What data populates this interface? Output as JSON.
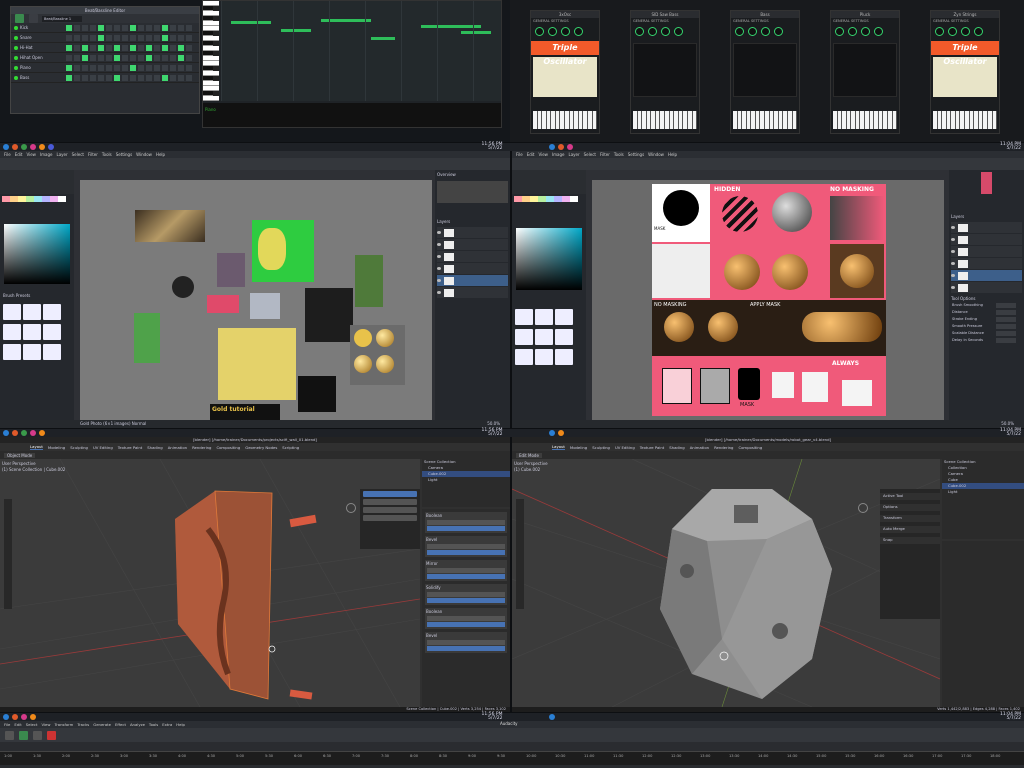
{
  "q1": {
    "beat_editor_title": "Beat/Bassline Editor",
    "beat_selector": "Beat/Bassline 1",
    "tracks": [
      "Kick",
      "Snare",
      "Hi-Hat",
      "Hihat Open",
      "Piano",
      "Bass"
    ],
    "piano_label": "Piano"
  },
  "q2": {
    "synths": [
      {
        "title": "3xOsc",
        "banner": "Triple Oscillator",
        "type": "triple"
      },
      {
        "title": "SID Saw Bass",
        "banner": "",
        "type": "dark"
      },
      {
        "title": "Bass",
        "banner": "",
        "type": "dark"
      },
      {
        "title": "Pluck",
        "banner": "",
        "type": "dark"
      },
      {
        "title": "Zyn Strings",
        "banner": "Triple Oscillator",
        "type": "triple"
      }
    ],
    "general_settings": "GENERAL SETTINGS"
  },
  "taskbars": {
    "clock_time": "11:56 PM",
    "clock_date": "5/7/22",
    "right_clock_time": "11:04 PM",
    "right_clock_date": "5/7/22"
  },
  "krita_left": {
    "title": "rewrite_progression_008.kra (2.0 GiB) * — Krita",
    "menu": [
      "File",
      "Edit",
      "View",
      "Image",
      "Layer",
      "Select",
      "Filter",
      "Tools",
      "Settings",
      "Window",
      "Help"
    ],
    "overview_title": "Overview",
    "layers_title": "Layers",
    "brush_presets_title": "Brush Presets",
    "status_left": "Gold Photo (6×1 images)   Normal",
    "zoom": "50.0%"
  },
  "krita_right": {
    "title": "spheres_003.kra (2.0 GiB) — Krita",
    "menu": [
      "File",
      "Edit",
      "View",
      "Image",
      "Layer",
      "Select",
      "Filter",
      "Tools",
      "Settings",
      "Window",
      "Help"
    ],
    "layers_title": "Layers",
    "tool_options_title": "Tool Options",
    "panels": [
      {
        "label": "MASK",
        "sub": "BLACK=SHOW\nWHITE=HIDE"
      },
      {
        "label": "HIDDEN",
        "sub": "SIMPLY HIDE PART OF LAYER"
      },
      {
        "label": "NO MASKING",
        "sub": ""
      },
      {
        "label": "NO MASKING",
        "sub": ""
      },
      {
        "label": "APPLY MASK",
        "sub": "TO MAKE IT PERMANENT"
      },
      {
        "label": "ALWAYS",
        "sub": "NON DESTRUCTIVE"
      },
      {
        "label": "MASK",
        "sub": ""
      }
    ],
    "tool_labels": [
      "Brush Smoothing",
      "Distance",
      "Stroke Ending",
      "Smooth Pressure",
      "Scalable Distance",
      "Delay in Seconds"
    ],
    "zoom": "50.0%"
  },
  "blender_left": {
    "title": "[blender] [/home/trainer/Documents/projects/scifi_wall_01.blend]",
    "workspaces": [
      "Layout",
      "Modeling",
      "Sculpting",
      "UV Editing",
      "Texture Paint",
      "Shading",
      "Animation",
      "Rendering",
      "Compositing",
      "Geometry Nodes",
      "Scripting"
    ],
    "mode": "Object Mode",
    "viewport_label": "User Perspective",
    "collection_label": "(1) Scene Collection | Cube.002",
    "outliner_items": [
      "Scene Collection",
      "Camera",
      "Cube.002",
      "Light"
    ],
    "props": [
      "Transform",
      "Delta Transform",
      "Relations",
      "Collections",
      "Instancing",
      "Motion Paths",
      "Visibility"
    ],
    "modifiers": [
      "Boolean",
      "Bevel",
      "Mirror",
      "Solidify",
      "Boolean",
      "Bevel"
    ],
    "status": "Scene Collection | Cube.002 | Verts 3,254 | Faces 3,102"
  },
  "blender_right": {
    "title": "[blender] [/home/trainer/Documents/models/robot_gear_v4.blend]",
    "workspaces": [
      "Layout",
      "Modeling",
      "Sculpting",
      "UV Editing",
      "Texture Paint",
      "Shading",
      "Animation",
      "Rendering",
      "Compositing"
    ],
    "mode": "Edit Mode",
    "viewport_label": "User Perspective",
    "collection_label": "(1) Cube.002",
    "outliner_items": [
      "Scene Collection",
      "Collection",
      "Camera",
      "Cube",
      "Cube.002",
      "Light"
    ],
    "props": [
      "Active Tool",
      "Options",
      "Transform",
      "Auto Merge",
      "Snap"
    ],
    "status": "Verts 1,442/2,883 | Edges 4,288 | Faces 1,402"
  },
  "bottom": {
    "menu": [
      "File",
      "Edit",
      "Select",
      "View",
      "Transform",
      "Tracks",
      "Generate",
      "Effect",
      "Analyze",
      "Tools",
      "Extra",
      "Help"
    ],
    "project": "Audacity",
    "timecodes": [
      "1:00",
      "1:30",
      "2:00",
      "2:30",
      "3:00",
      "3:30",
      "4:00",
      "4:30",
      "5:00",
      "5:30",
      "6:00",
      "6:30",
      "7:00",
      "7:30",
      "8:00",
      "8:30",
      "9:00",
      "9:30",
      "10:00",
      "10:30",
      "11:00",
      "11:30",
      "12:00",
      "12:30",
      "13:00",
      "13:30",
      "14:00",
      "14:30",
      "15:00",
      "15:30",
      "16:00",
      "16:30",
      "17:00",
      "17:30",
      "18:00"
    ]
  }
}
